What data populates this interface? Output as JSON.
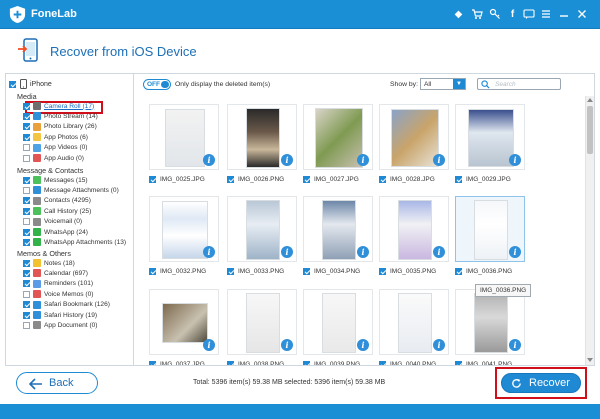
{
  "app": {
    "name": "FoneLab"
  },
  "header": {
    "title": "Recover from iOS Device"
  },
  "sidebar": {
    "root_label": "iPhone",
    "sections": [
      {
        "title": "Media",
        "items": [
          {
            "label": "Camera Roll (17)",
            "icon": "camera-roll-icon",
            "checked": true,
            "selected": true
          },
          {
            "label": "Photo Stream (14)",
            "icon": "photo-stream-icon",
            "checked": true
          },
          {
            "label": "Photo Library (26)",
            "icon": "photo-library-icon",
            "checked": true
          },
          {
            "label": "App Photos (6)",
            "icon": "app-photos-icon",
            "checked": true
          },
          {
            "label": "App Videos (0)",
            "icon": "app-videos-icon",
            "checked": false
          },
          {
            "label": "App Audio (0)",
            "icon": "app-audio-icon",
            "checked": false
          }
        ]
      },
      {
        "title": "Message & Contacts",
        "items": [
          {
            "label": "Messages (15)",
            "icon": "messages-icon",
            "checked": true
          },
          {
            "label": "Message Attachments (0)",
            "icon": "message-attachments-icon",
            "checked": false
          },
          {
            "label": "Contacts (4295)",
            "icon": "contacts-icon",
            "checked": true
          },
          {
            "label": "Call History (25)",
            "icon": "call-history-icon",
            "checked": true
          },
          {
            "label": "Voicemail (0)",
            "icon": "voicemail-icon",
            "checked": false
          },
          {
            "label": "WhatsApp (24)",
            "icon": "whatsapp-icon",
            "checked": true
          },
          {
            "label": "WhatsApp Attachments (13)",
            "icon": "whatsapp-attachments-icon",
            "checked": true
          }
        ]
      },
      {
        "title": "Memos & Others",
        "items": [
          {
            "label": "Notes (18)",
            "icon": "notes-icon",
            "checked": true
          },
          {
            "label": "Calendar (697)",
            "icon": "calendar-icon",
            "checked": true
          },
          {
            "label": "Reminders (101)",
            "icon": "reminders-icon",
            "checked": true
          },
          {
            "label": "Voice Memos (0)",
            "icon": "voice-memos-icon",
            "checked": false
          },
          {
            "label": "Safari Bookmark (126)",
            "icon": "safari-bookmark-icon",
            "checked": true
          },
          {
            "label": "Safari History (19)",
            "icon": "safari-history-icon",
            "checked": true
          },
          {
            "label": "App Document (0)",
            "icon": "app-document-icon",
            "checked": false
          }
        ]
      }
    ]
  },
  "toolbar": {
    "toggle_label": "OFF",
    "deleted_only_label": "Only display the deleted item(s)",
    "show_by_label": "Show by:",
    "show_by_value": "All",
    "search_placeholder": "Search"
  },
  "photos": [
    "IMG_0025.JPG",
    "IMG_0026.PNG",
    "IMG_0027.JPG",
    "IMG_0028.JPG",
    "IMG_0029.JPG",
    "IMG_0032.PNG",
    "IMG_0033.PNG",
    "IMG_0034.PNG",
    "IMG_0035.PNG",
    "IMG_0036.PNG",
    "IMG_0037.JPG",
    "IMG_0038.PNG",
    "IMG_0039.PNG",
    "IMG_0040.PNG",
    "IMG_0041.PNG"
  ],
  "tooltip": "IMG_0036.PNG",
  "footer": {
    "back_label": "Back",
    "status": "Total: 5396 item(s) 59.38 MB   selected: 5396 item(s) 59.38 MB",
    "recover_label": "Recover"
  },
  "colors": {
    "brand": "#1a8fd6",
    "accent": "#1f8ad3",
    "highlight": "#d10f1a"
  }
}
